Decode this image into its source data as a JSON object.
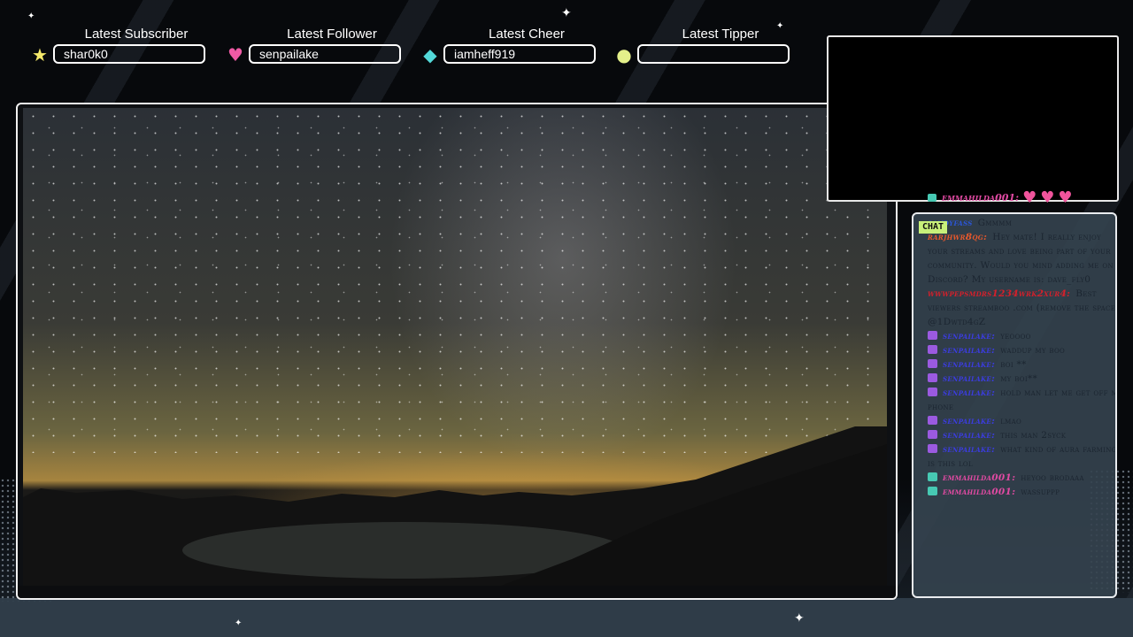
{
  "stats": [
    {
      "title": "Latest Subscriber",
      "value": "shar0k0",
      "icon": "star-icon",
      "color": "#f4e96a"
    },
    {
      "title": "Latest Follower",
      "value": "senpailake",
      "icon": "heart-icon",
      "color": "#ef5aa5"
    },
    {
      "title": "Latest Cheer",
      "value": "iamheff919",
      "icon": "diamond-icon",
      "color": "#53d9d9"
    },
    {
      "title": "Latest Tipper",
      "value": "",
      "icon": "coin-icon",
      "color": "#e4f08a"
    }
  ],
  "hearts_row": {
    "user": "emmahilda001:"
  },
  "chat": {
    "tag": "CHAT",
    "messages": [
      {
        "user": "sandyfass",
        "text": "Gmmmm",
        "color": "#2b56d8",
        "badge": ""
      },
      {
        "user": "rarjhwr8qg:",
        "text": "Hey mate! I really enjoy your streams and love being part of your community. Would you mind adding me on Discord? My username is: dave_fly0",
        "color": "#e8582c",
        "badge": ""
      },
      {
        "user": "wwwpepsmdrs1234wrk2xur4:",
        "text": "Best viewers streamboo .com (remove the space) @1Dwtd4gZ",
        "color": "#d4202b",
        "badge": ""
      },
      {
        "user": "senpailake:",
        "text": "yeoooo",
        "color": "#3b3ce0",
        "badge": "#9b5ae0"
      },
      {
        "user": "senpailake:",
        "text": "waddup my boo",
        "color": "#3b3ce0",
        "badge": "#9b5ae0"
      },
      {
        "user": "senpailake:",
        "text": "boi **",
        "color": "#3b3ce0",
        "badge": "#9b5ae0"
      },
      {
        "user": "senpailake:",
        "text": "my boi**",
        "color": "#3b3ce0",
        "badge": "#9b5ae0"
      },
      {
        "user": "senpailake:",
        "text": "hold man let me get off my phone",
        "color": "#3b3ce0",
        "badge": "#9b5ae0"
      },
      {
        "user": "senpailake:",
        "text": "lmao",
        "color": "#3b3ce0",
        "badge": "#9b5ae0"
      },
      {
        "user": "senpailake:",
        "text": "this man 2syck",
        "color": "#3b3ce0",
        "badge": "#9b5ae0"
      },
      {
        "user": "senpailake:",
        "text": "what kind of aura farming is this lol",
        "color": "#3b3ce0",
        "badge": "#9b5ae0"
      },
      {
        "user": "emmahilda001:",
        "text": "heyoo brodaaa",
        "color": "#e24aa3",
        "badge": "#47c9b3"
      },
      {
        "user": "emmahilda001:",
        "text": "wassuppp",
        "color": "#e24aa3",
        "badge": "#47c9b3"
      }
    ]
  }
}
